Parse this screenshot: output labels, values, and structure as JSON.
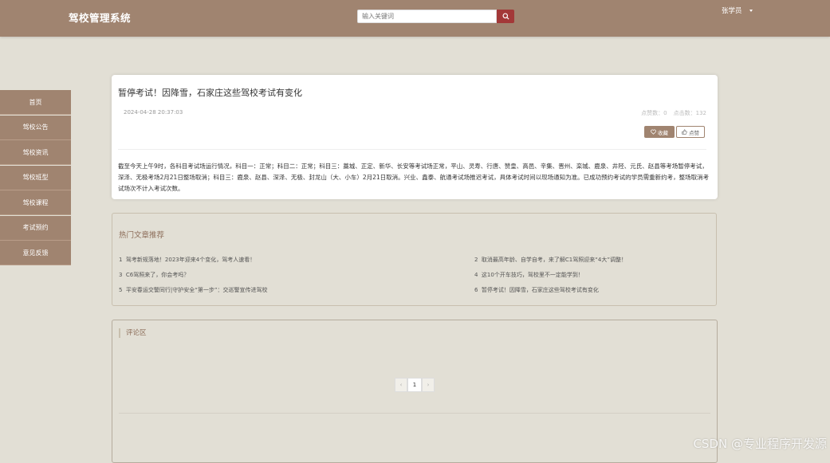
{
  "header": {
    "site_title": "驾校管理系统",
    "search_placeholder": "输入关键词",
    "username": "张学员"
  },
  "sidebar": {
    "items": [
      {
        "label": "首页"
      },
      {
        "label": "驾校公告"
      },
      {
        "label": "驾校资讯"
      },
      {
        "label": "驾校班型"
      },
      {
        "label": "驾校课程"
      },
      {
        "label": "考试预约"
      },
      {
        "label": "意见反馈"
      }
    ]
  },
  "article": {
    "title": "暂停考试！因降雪，石家庄这些驾校考试有变化",
    "date": "2024-04-28 20:37:03",
    "fav_count_label": "点赞数：0",
    "click_count_label": "点击数：132",
    "fav_button": "收藏",
    "like_button": "点赞",
    "body": "截至今天上午9时，各科目考试场运行情况，科目一：正常；科目二：正常；科目三：藁城、正定、新华、长安等考试场正常，平山、灵寿、行唐、赞皇、高邑、辛集、晋州、栾城、鹿泉、井陉、元氏、赵县等考场暂停考试，深泽、无极考场2月21日整场取消；科目三：鹿泉、赵县、深泽、无极、封龙山（大、小车）2月21日取消。兴业、鑫泰、航通考试场推迟考试，具体考试时间以现场通知为准。已成功预约考试的学员需重新约考，整场取消考试场次不计入考试次数。"
  },
  "hot": {
    "title": "热门文章推荐",
    "items": [
      {
        "num": "1",
        "text": "驾考新规落地！2023年迎来4个变化，驾考人速看！"
      },
      {
        "num": "2",
        "text": "取消最高年龄、自学自考，来了解C1驾照迎来“4大”调整！"
      },
      {
        "num": "3",
        "text": "C6驾照来了，你会考吗？"
      },
      {
        "num": "4",
        "text": "这10个开车技巧，驾校里不一定能学到！"
      },
      {
        "num": "5",
        "text": "平安春运交警同行|守护安全“第一步”：交巡警宣传进驾校"
      },
      {
        "num": "6",
        "text": "暂停考试！因降雪，石家庄这些驾校考试有变化"
      }
    ]
  },
  "comments": {
    "title": "评论区",
    "pager": {
      "prev": "‹",
      "current": "1",
      "next": "›"
    }
  },
  "watermark": "CSDN @专业程序开发源"
}
